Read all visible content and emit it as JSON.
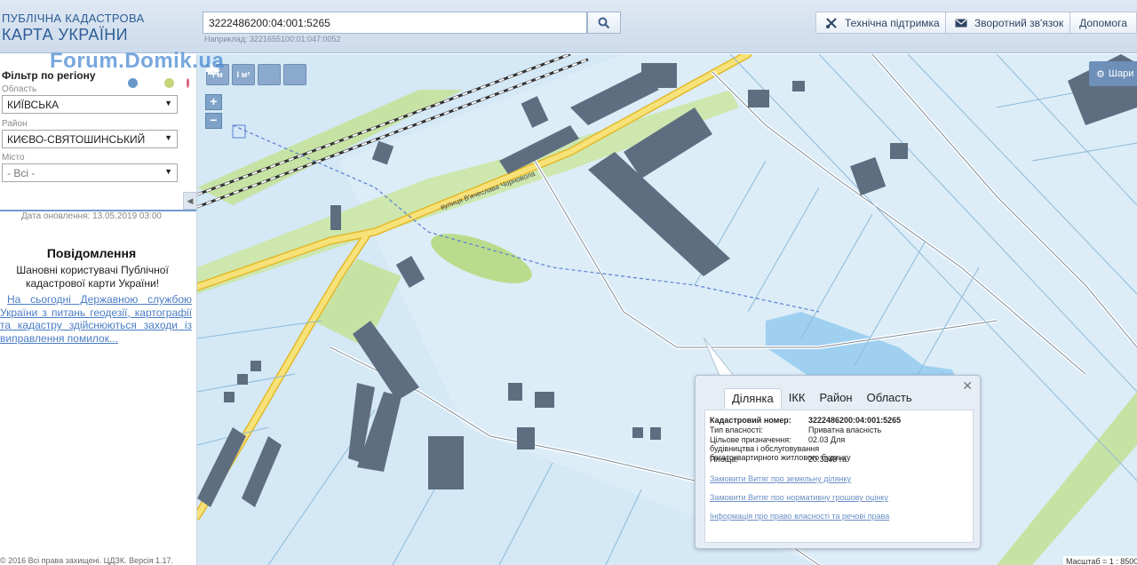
{
  "header": {
    "logo_line1": "ПУБЛІЧНА КАДАСТРОВА",
    "logo_line2": "КАРТА УКРАЇНИ",
    "search_value": "3222486200:04:001:5265",
    "search_hint": "Наприклад: 3221655100:01:047:0052",
    "support_label": "Технічна підтримка",
    "feedback_label": "Зворотний зв'язок",
    "help_label": "Допомога"
  },
  "sidebar": {
    "watermark": "Forum.Domik.ua",
    "filter_title": "Фільтр по регіону",
    "dots": [
      "#6a98c9",
      "#c8d47a",
      "#e04060"
    ],
    "oblast_label": "Область",
    "oblast_value": "КИЇВСЬКА",
    "raion_label": "Район",
    "raion_value": "КИЄВО-СВЯТОШИНСЬКИЙ",
    "misto_label": "Місто",
    "misto_value": "- Всі -",
    "update_date": "Дата оновлення: 13.05.2019 03:00",
    "notice_title": "Повідомлення",
    "notice_text": "Шановні користувачі Публічної кадастрової карти України!",
    "notice_link": "На сьогодні Державною службою України з питань геодезії, картографії та кадастру здійснюються заходи із виправлення помилок...",
    "copyright": "© 2016 Всі права захищені. ЦДЗК. Версія 1.17."
  },
  "map": {
    "toolbar": [
      "I м",
      "I м²",
      "print",
      "?"
    ],
    "zoom_in": "+",
    "zoom_out": "−",
    "layers_label": "Шари",
    "scale_label": "Масштаб = 1 : 8500",
    "road_label": "вулиця В'ячеслава Чорновола"
  },
  "popup": {
    "tabs": [
      "Ділянка",
      "ІКК",
      "Район",
      "Область"
    ],
    "active_tab": "Ділянка",
    "close": "✕",
    "rows": [
      {
        "key": "Кадастровий номер:",
        "value": "3222486200:04:001:5265"
      },
      {
        "key": "Тип власності:",
        "value": "Приватна власність"
      },
      {
        "key": "Цільове призначення:",
        "value": "02.03 Для будівництва і обслуговування багатоквартирного житлового будинку"
      },
      {
        "key": "Площа:",
        "value": "20.3249 га"
      }
    ],
    "links": [
      "Замовити Витяг про земельну ділянку",
      "Замовити Витяг про нормативну грошову оцінку",
      "Інформація про право власності та речові права"
    ]
  },
  "colors": {
    "header_bg": "#d6e2f0",
    "brand": "#2d5d95",
    "map_bg": "#d4e8f6",
    "building": "#5e6e80",
    "road": "#f4d94a",
    "green": "#b9dc8c",
    "water": "#9fd0f0"
  }
}
